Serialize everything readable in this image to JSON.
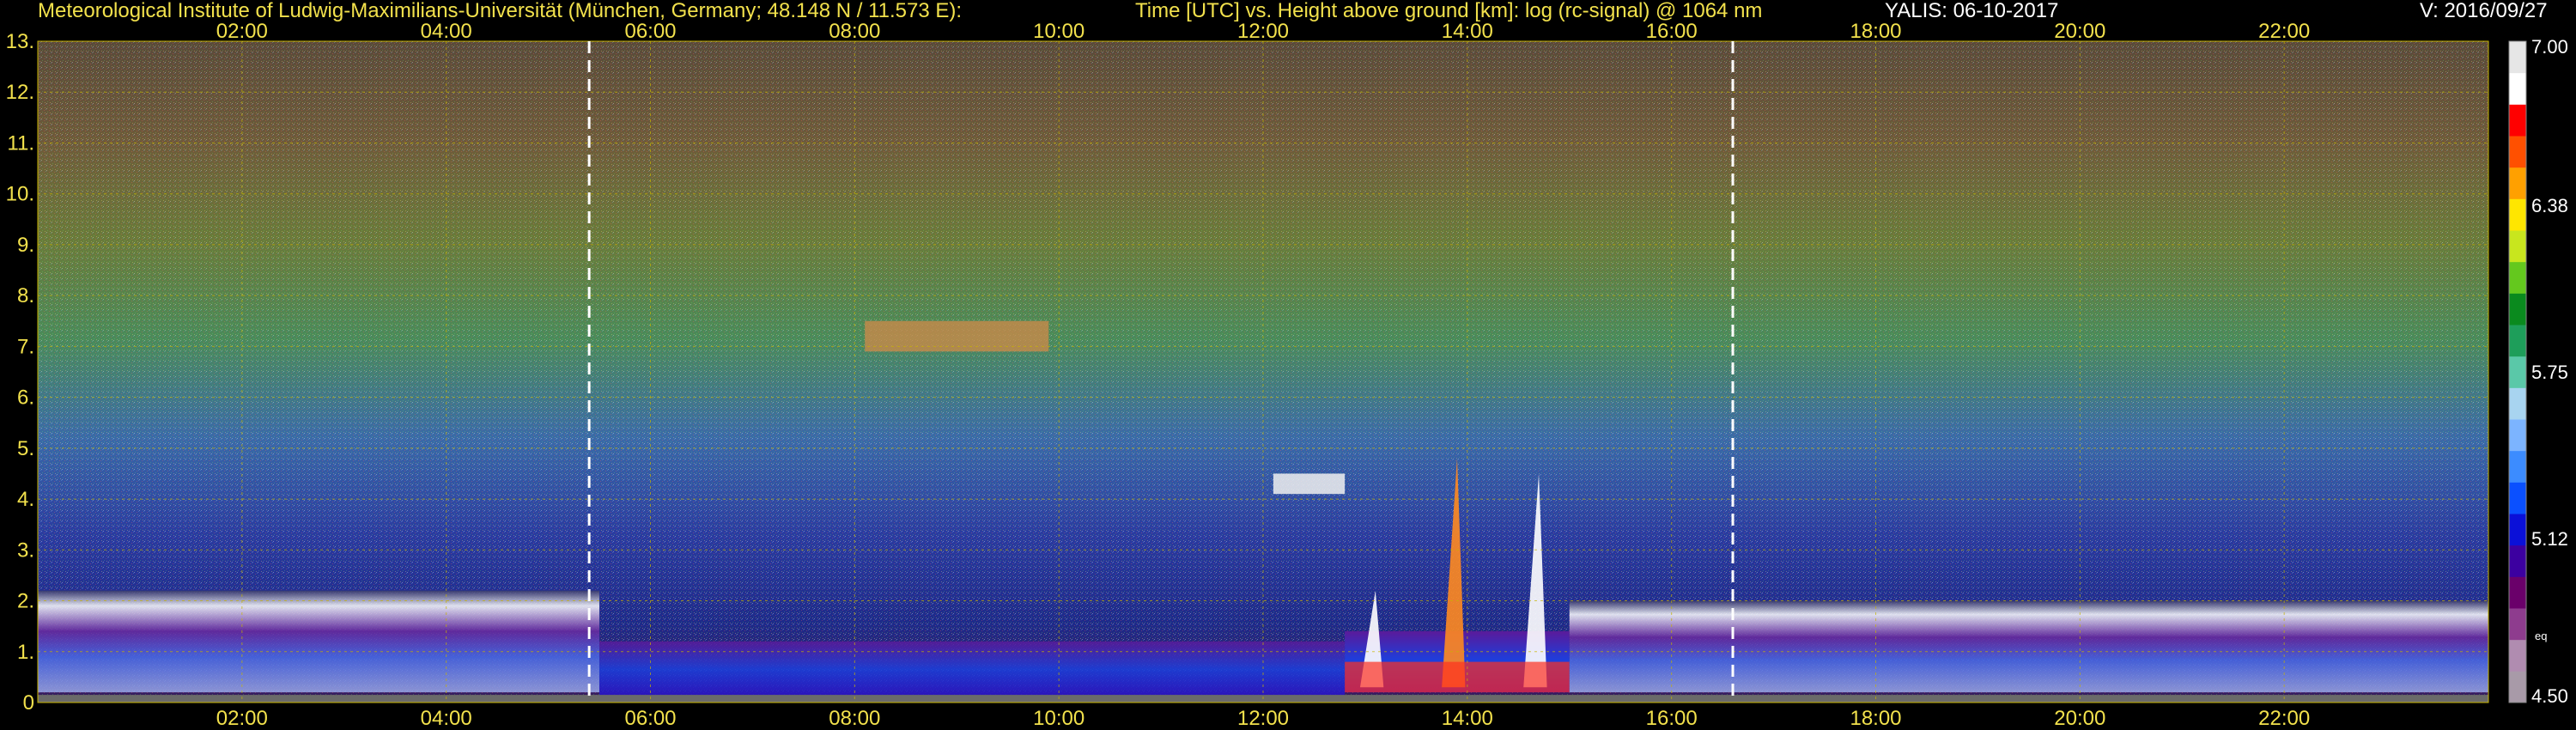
{
  "header": {
    "institute": "Meteorological Institute of Ludwig-Maximilians-Universität (München, Germany; 48.148 N / 11.573 E):",
    "description": "Time [UTC] vs. Height above ground [km]: log (rc-signal) @ 1064 nm",
    "instrument_date": "YALIS: 06-10-2017",
    "version": "V: 2016/09/27"
  },
  "colors": {
    "background": "#000000",
    "title": "#f2e14c",
    "axis_labels": "#f2e14c",
    "grid": "#c8b400",
    "sunrise_sunset_lines": "#ffffff"
  },
  "chart_data": {
    "type": "heatmap",
    "x_axis": {
      "unit": "Time [UTC]",
      "range_hours": [
        0,
        24
      ],
      "tick_values_hours": [
        2,
        4,
        6,
        8,
        10,
        12,
        14,
        16,
        18,
        20,
        22
      ],
      "tick_labels": [
        "02:00",
        "04:00",
        "06:00",
        "08:00",
        "10:00",
        "12:00",
        "14:00",
        "16:00",
        "18:00",
        "20:00",
        "22:00"
      ],
      "shown_top_and_bottom": true
    },
    "y_axis": {
      "unit": "Height above ground [km]",
      "range_km": [
        0,
        13
      ],
      "tick_values_km": [
        0,
        1,
        2,
        3,
        4,
        5,
        6,
        7,
        8,
        9,
        10,
        11,
        12,
        13
      ],
      "tick_labels": [
        "0",
        "1.",
        "2.",
        "3.",
        "4.",
        "5.",
        "6.",
        "7.",
        "8.",
        "9.",
        "10.",
        "11.",
        "12.",
        "13."
      ]
    },
    "dashed_vertical_markers_hours": [
      5.4,
      16.6
    ],
    "grid": true,
    "colorbar": {
      "quantity": "log (rc-signal) @ 1064 nm",
      "range": [
        4.5,
        7.0
      ],
      "tick_values": [
        4.5,
        5.12,
        5.75,
        6.38,
        7.0
      ],
      "tick_labels": [
        "4.50",
        "5.12",
        "5.75",
        "6.38",
        "7.00"
      ],
      "small_label": "eq",
      "colors_bottom_to_top": [
        "#a89aa8",
        "#b08cb0",
        "#8e3c8e",
        "#6a006a",
        "#3c00a0",
        "#0a10d8",
        "#0a50ff",
        "#3c8cff",
        "#7cb4ff",
        "#a8d4f0",
        "#5ac8a8",
        "#1e9e5a",
        "#0a8a1e",
        "#64c81e",
        "#c8e61e",
        "#ffe600",
        "#ffa000",
        "#ff5000",
        "#ff0000",
        "#ffffff",
        "#e6e6e6"
      ]
    },
    "features": [
      {
        "description": "Boundary layer / cloud base structure",
        "start_hour": 0,
        "end_hour": 5.5,
        "height_km": [
          0.2,
          2.2
        ]
      },
      {
        "description": "Stratified layer near ground",
        "start_hour": 5.5,
        "end_hour": 12.8,
        "height_km": [
          0.1,
          1.2
        ]
      },
      {
        "description": "Elevated cloud",
        "start_hour": 12.1,
        "end_hour": 12.8,
        "height_km": [
          4.1,
          4.5
        ]
      },
      {
        "description": "Mid-level aerosol",
        "start_hour": 8.1,
        "end_hour": 9.9,
        "height_km": [
          6.9,
          7.5
        ]
      },
      {
        "description": "Convective plumes",
        "start_hour": 12.8,
        "end_hour": 15.0,
        "height_km": [
          0.2,
          4.8
        ]
      },
      {
        "description": "Evening cloud layer",
        "start_hour": 15.0,
        "end_hour": 24.0,
        "height_km": [
          0.2,
          2.0
        ]
      }
    ]
  }
}
